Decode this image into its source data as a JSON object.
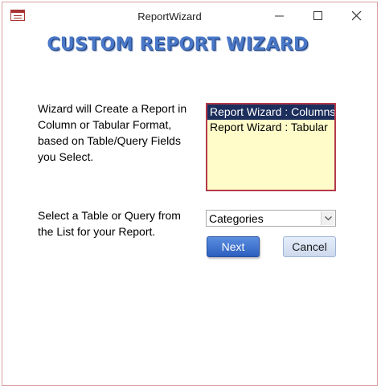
{
  "window": {
    "title": "ReportWizard",
    "app_icon": "form-icon"
  },
  "header": {
    "heading": "CUSTOM REPORT WIZARD"
  },
  "description": {
    "text1": "Wizard will Create a Report in Column or Tabular Format, based on Table/Query Fields you Select.",
    "text2": "Select a Table or Query from the List for your Report."
  },
  "report_list": {
    "items": [
      {
        "label": "Report Wizard : Columns",
        "selected": true
      },
      {
        "label": "Report Wizard : Tabular",
        "selected": false
      }
    ]
  },
  "source_combo": {
    "value": "Categories"
  },
  "buttons": {
    "next": "Next",
    "cancel": "Cancel"
  },
  "colors": {
    "heading": "#4a78c8",
    "listbox_bg": "#fffcc9",
    "listbox_border": "#b43a4b",
    "selection": "#1c2e5c",
    "next_button": "#2c5fbf"
  }
}
